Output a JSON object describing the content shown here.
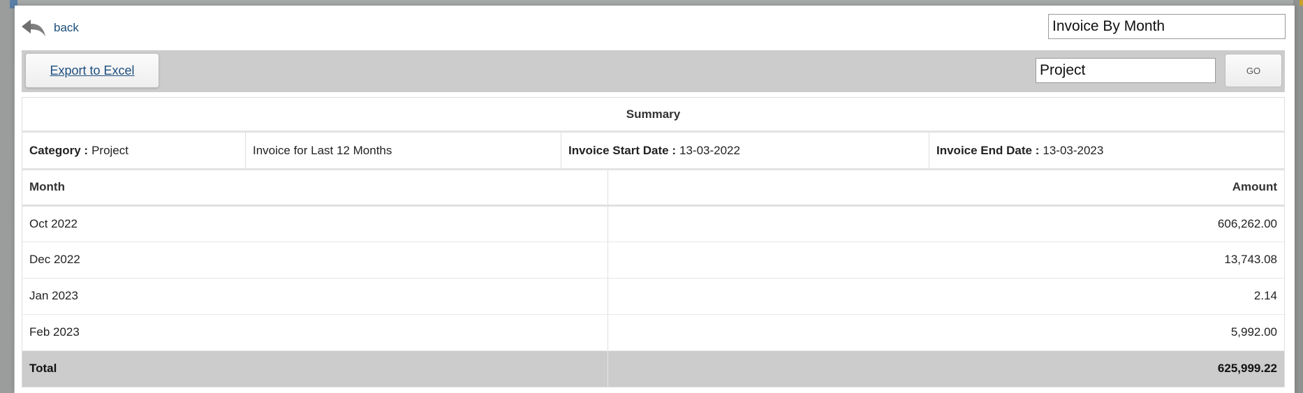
{
  "header": {
    "back_label": "back",
    "report_type": "Invoice By Month"
  },
  "toolbar": {
    "export_label": "Export to Excel",
    "category_value": "Project",
    "go_label": "GO"
  },
  "summary": {
    "title": "Summary",
    "category_label": "Category :",
    "category_value": "Project",
    "period": "Invoice for Last 12 Months",
    "start_label": "Invoice Start Date :",
    "start_value": "13-03-2022",
    "end_label": "Invoice End Date :",
    "end_value": "13-03-2023"
  },
  "table": {
    "columns": [
      "Month",
      "Amount"
    ],
    "rows": [
      {
        "month": "Oct 2022",
        "amount": "606,262.00"
      },
      {
        "month": "Dec 2022",
        "amount": "13,743.08"
      },
      {
        "month": "Jan 2023",
        "amount": "2.14"
      },
      {
        "month": "Feb 2023",
        "amount": "5,992.00"
      }
    ],
    "total": {
      "label": "Total",
      "amount": "625,999.22"
    }
  },
  "colors": {
    "link": "#1a4d7a",
    "toolbar_bg": "#cccccc",
    "total_row_bg": "#cccccc"
  },
  "icons": {
    "back": "back-arrow-icon"
  }
}
